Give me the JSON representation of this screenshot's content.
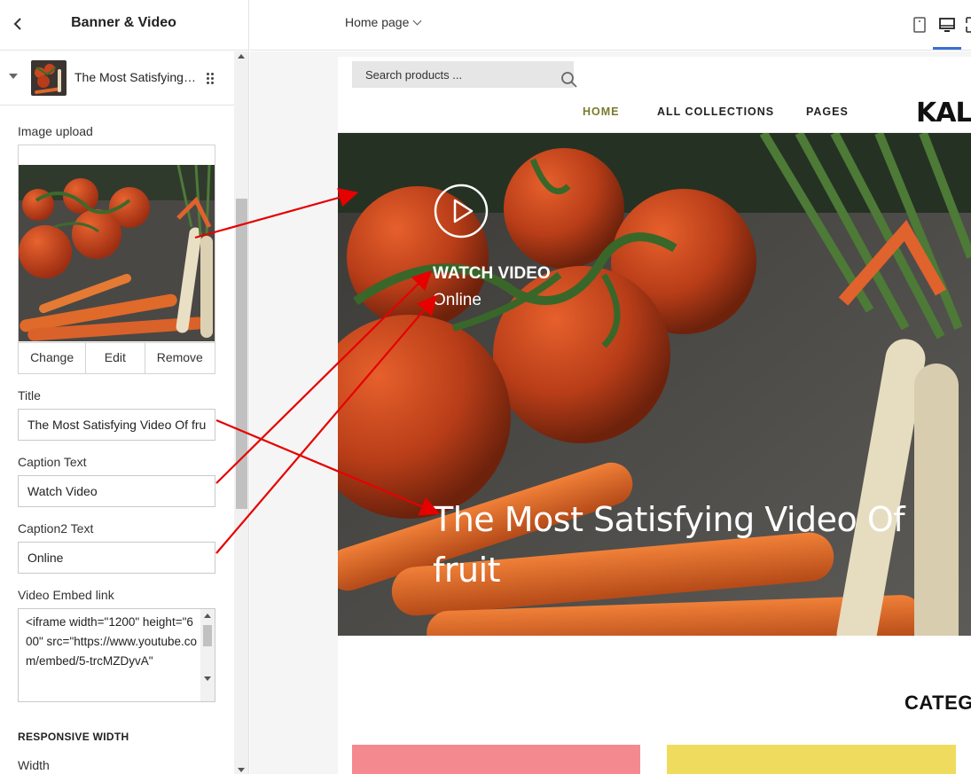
{
  "panel": {
    "title": "Banner & Video",
    "block_label": "The Most Satisfying…",
    "image_upload_label": "Image upload",
    "image_actions": {
      "change": "Change",
      "edit": "Edit",
      "remove": "Remove"
    },
    "title_label": "Title",
    "title_value": "The Most Satisfying Video Of fru",
    "caption_label": "Caption Text",
    "caption_value": "Watch Video",
    "caption2_label": "Caption2 Text",
    "caption2_value": "Online",
    "video_label": "Video Embed link",
    "video_value": "<iframe width=\"1200\" height=\"600\" src=\"https://www.youtube.com/embed/5-trcMZDyvA\"",
    "responsive_heading": "RESPONSIVE WIDTH",
    "width_label": "Width"
  },
  "topbar": {
    "page_select": "Home page",
    "device_icons": [
      "mobile-icon",
      "desktop-icon",
      "fullscreen-icon"
    ]
  },
  "preview": {
    "search_placeholder": "Search products ...",
    "nav": [
      "HOME",
      "ALL COLLECTIONS",
      "PAGES"
    ],
    "logo": "KAL",
    "banner": {
      "caption": "WATCH VIDEO",
      "caption2": "Online",
      "title": "The Most Satisfying Video Of fruit"
    },
    "section_heading": "CATEG"
  },
  "colors": {
    "nav_active": "#7a7a2e",
    "annotation_arrow": "#e60000",
    "card_pink": "#f48a8f",
    "card_yellow": "#efdc5e",
    "device_active": "#3b6fd1"
  }
}
